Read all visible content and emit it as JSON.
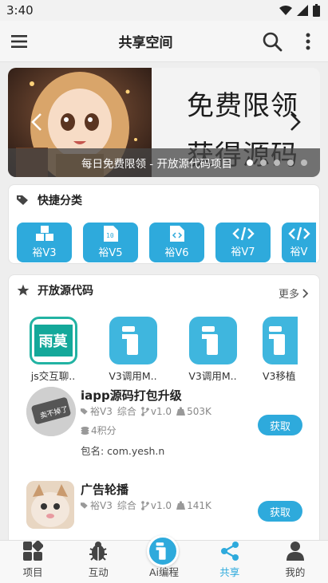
{
  "status_bar": {
    "time": "3:40"
  },
  "app_bar": {
    "title": "共享空间"
  },
  "banner": {
    "headline_1": "免费限领",
    "headline_2": "获得源码",
    "caption": "每日免费限领 - 开放源代码项目",
    "slide_count": 5,
    "active_slide": 1
  },
  "quick_category": {
    "title": "快捷分类",
    "items": [
      {
        "label": "裕V3",
        "icon": "cubes-icon"
      },
      {
        "label": "裕V5",
        "icon": "binary-file-icon"
      },
      {
        "label": "裕V6",
        "icon": "code-file-icon"
      },
      {
        "label": "裕V7",
        "icon": "code-brackets-icon"
      },
      {
        "label": "裕V",
        "icon": "code-brackets-icon"
      }
    ]
  },
  "open_source": {
    "title": "开放源代码",
    "more_label": "更多",
    "apps": [
      {
        "name": "js交互聊..",
        "icon_text": "雨莫"
      },
      {
        "name": "V3调用M..",
        "icon_text": ""
      },
      {
        "name": "V3调用M..",
        "icon_text": ""
      },
      {
        "name": "V3移植",
        "icon_text": ""
      }
    ],
    "resources": [
      {
        "title": "iapp源码打包升级",
        "version_tag": "裕V3",
        "category": "综合",
        "version": "v1.0",
        "size": "503K",
        "points": "4积分",
        "package": "包名: com.yesh.n",
        "button": "获取"
      },
      {
        "title": "广告轮播",
        "version_tag": "裕V3",
        "category": "综合",
        "version": "v1.0",
        "size": "141K",
        "button": "获取"
      }
    ]
  },
  "bottom_nav": {
    "items": [
      {
        "label": "项目",
        "icon": "grid-icon"
      },
      {
        "label": "互动",
        "icon": "bug-icon"
      },
      {
        "label": "Ai编程",
        "icon": "ai-icon"
      },
      {
        "label": "共享",
        "icon": "share-icon",
        "active": true
      },
      {
        "label": "我的",
        "icon": "person-icon"
      }
    ]
  },
  "colors": {
    "accent": "#2eaadc",
    "nav_active": "#2eaadc"
  }
}
